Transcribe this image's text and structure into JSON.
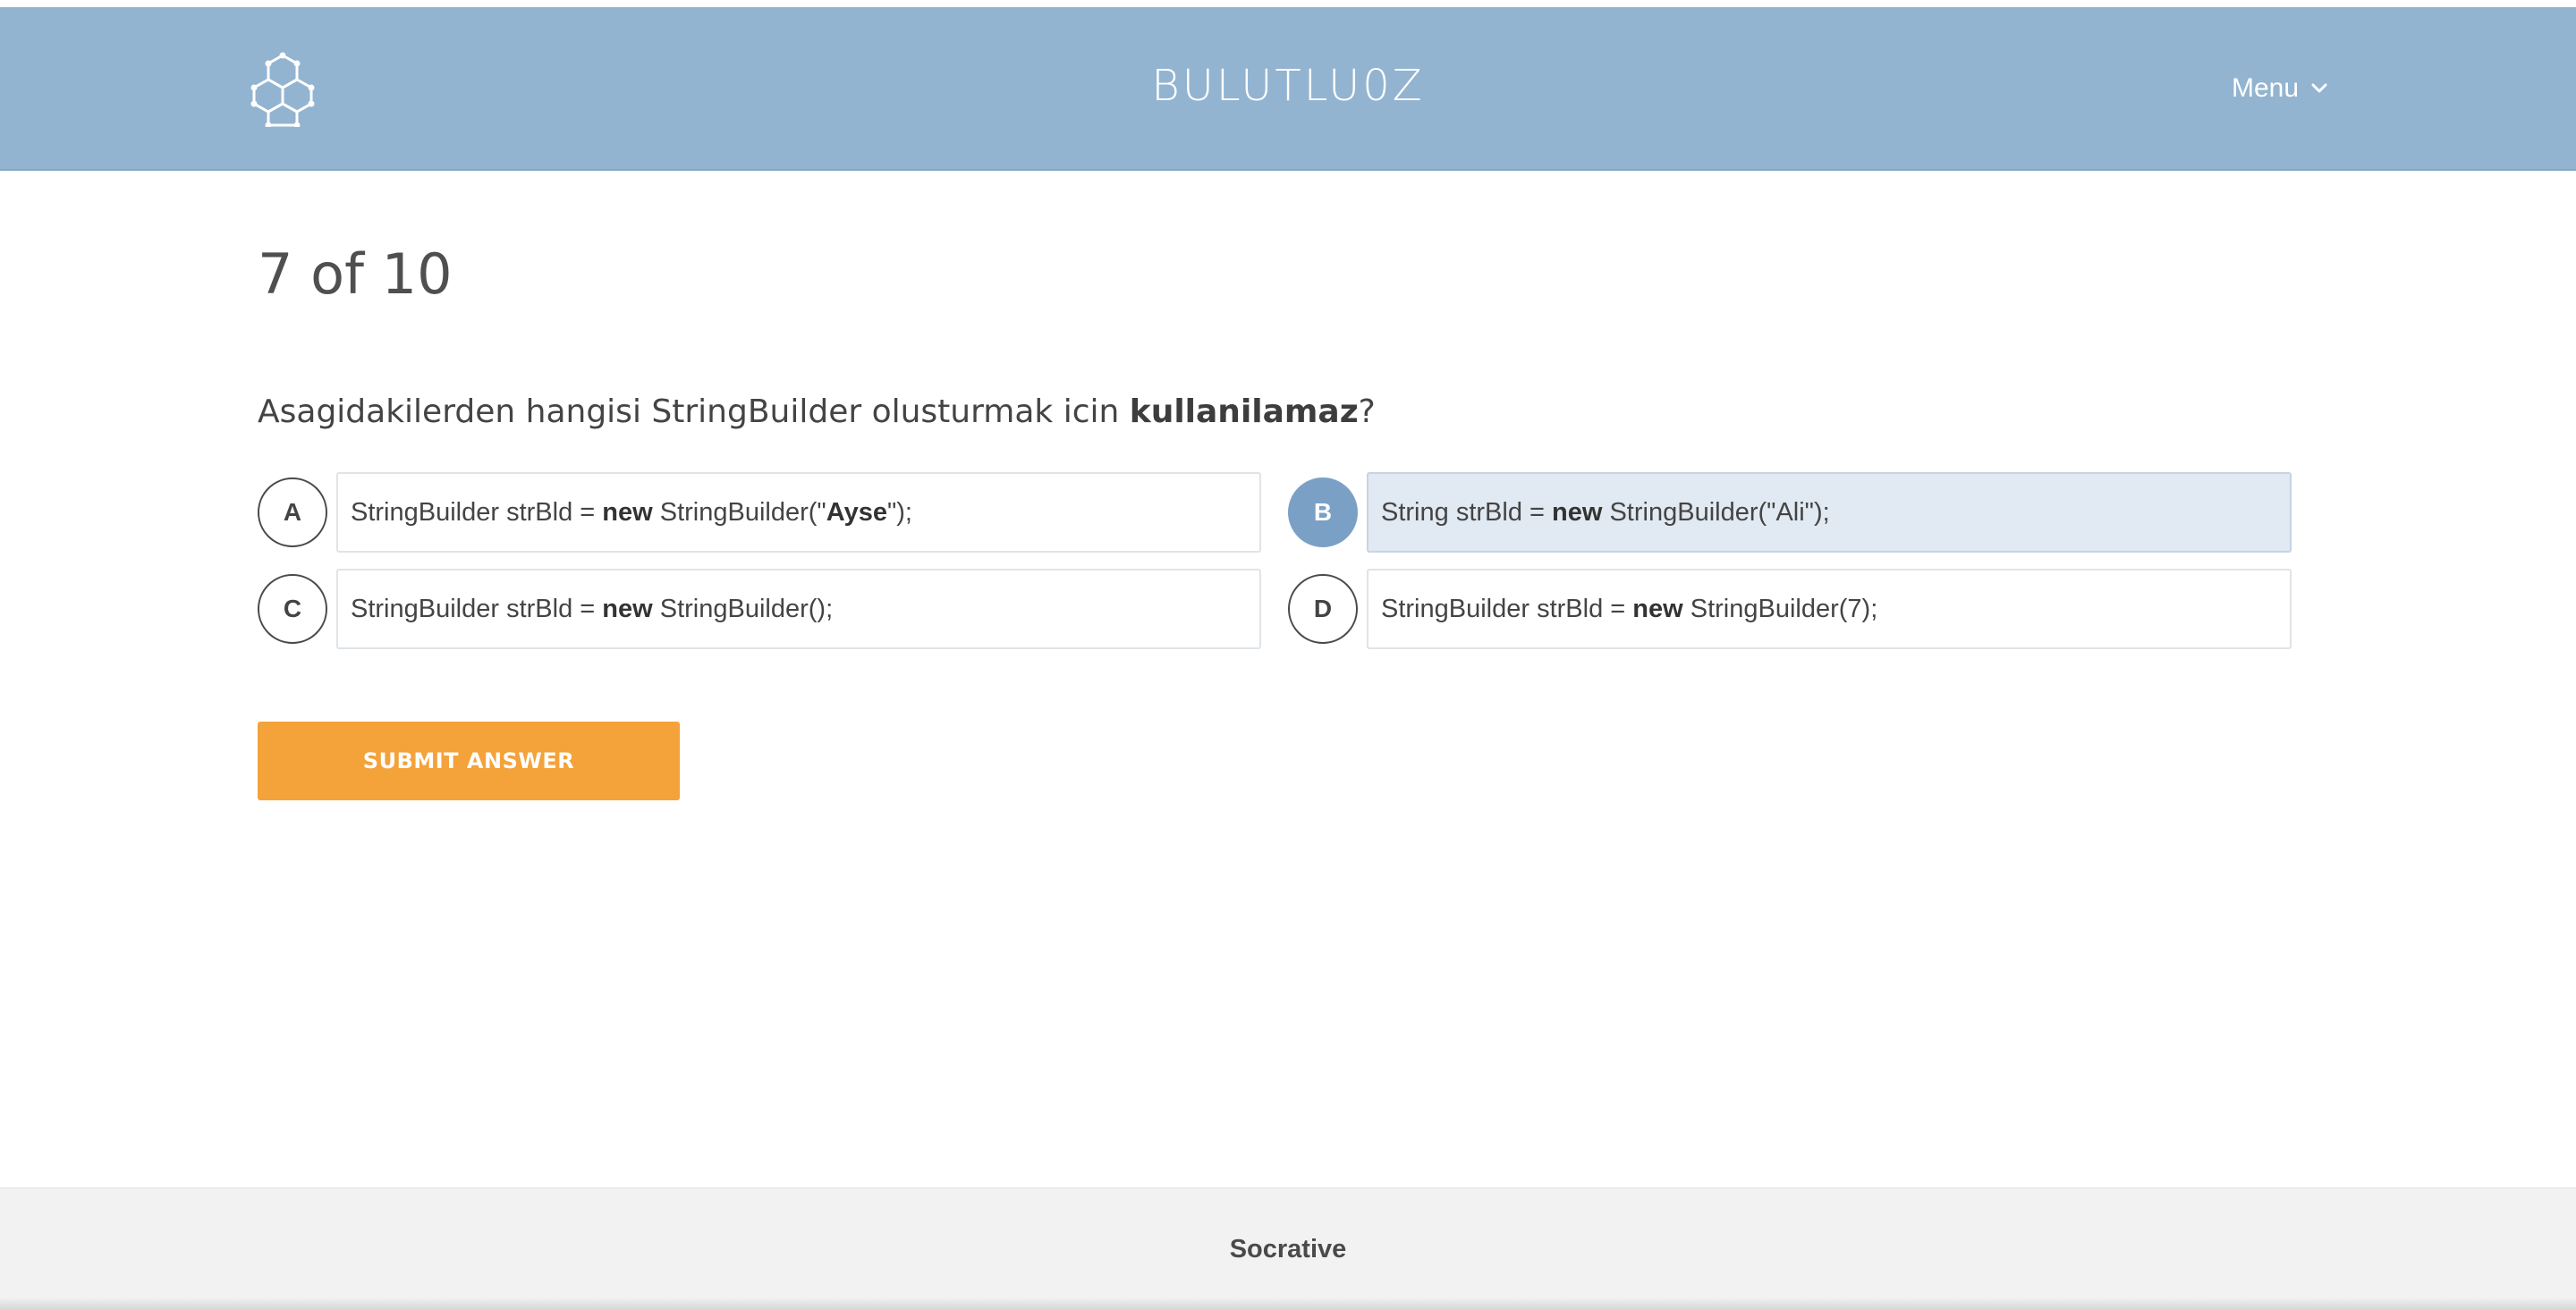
{
  "header": {
    "brand": "BULUTLU0Z",
    "logo_icon": "hexagon-molecule-icon",
    "menu_label": "Menu",
    "menu_icon": "chevron-down-icon",
    "background": "#93b4d0"
  },
  "quiz": {
    "progress": "7 of 10",
    "question": {
      "prefix": "Asagidakilerden hangisi StringBuilder olusturmak icin ",
      "emphasis": "kullanilamaz",
      "suffix": "?"
    },
    "selected": "B",
    "answers": [
      {
        "letter": "A",
        "parts": [
          {
            "text": "StringBuilder strBld = ",
            "bold": false
          },
          {
            "text": "new",
            "bold": true
          },
          {
            "text": " StringBuilder(\"",
            "bold": false
          },
          {
            "text": "Ayse",
            "bold": true
          },
          {
            "text": "\");",
            "bold": false
          }
        ]
      },
      {
        "letter": "B",
        "parts": [
          {
            "text": "String strBld = ",
            "bold": false
          },
          {
            "text": "new",
            "bold": true
          },
          {
            "text": " StringBuilder(\"Ali\");",
            "bold": false
          }
        ]
      },
      {
        "letter": "C",
        "parts": [
          {
            "text": "StringBuilder strBld = ",
            "bold": false
          },
          {
            "text": "new",
            "bold": true
          },
          {
            "text": " StringBuilder();",
            "bold": false
          }
        ]
      },
      {
        "letter": "D",
        "parts": [
          {
            "text": "StringBuilder strBld = ",
            "bold": false
          },
          {
            "text": "new",
            "bold": true
          },
          {
            "text": " StringBuilder(7);",
            "bold": false
          }
        ]
      }
    ],
    "submit_label": "SUBMIT ANSWER",
    "accent_color": "#f4a23a",
    "selected_color": "#7ba0c6"
  },
  "footer": {
    "label": "Socrative"
  }
}
